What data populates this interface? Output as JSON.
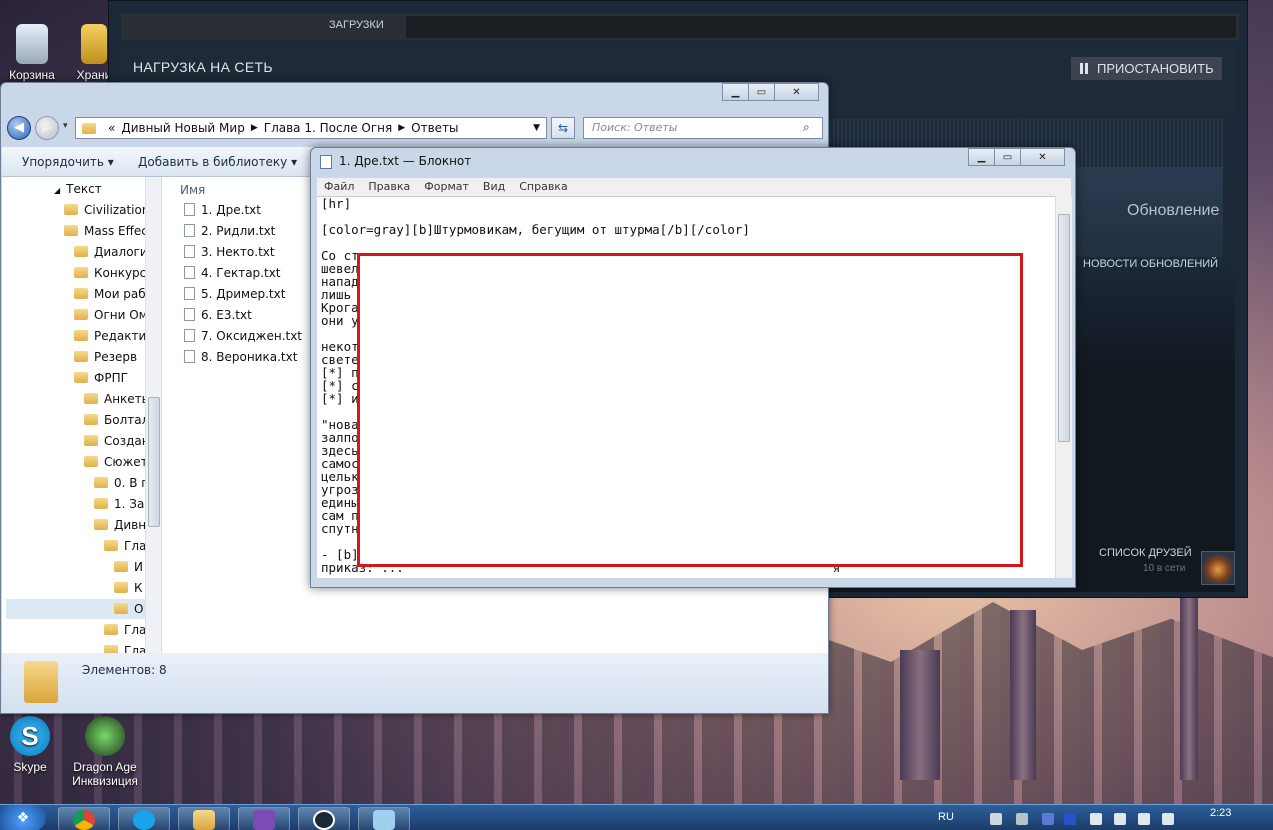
{
  "desktop": {
    "icons_top": [
      {
        "label": "Корзина"
      },
      {
        "label": "Храни"
      }
    ],
    "icons_bottom": [
      {
        "label": "Skype"
      },
      {
        "label": "Dragon Age Инквизиция"
      }
    ]
  },
  "steam": {
    "tab_downloads": "ЗАГРУЗКИ",
    "network_title": "НАГРУЗКА НА СЕТЬ",
    "pause_label": "ПРИОСТАНОВИТЬ",
    "updates_title": "Обновление",
    "update_news": "НОВОСТИ ОБНОВЛЕНИЙ",
    "friends_list": "СПИСОК ДРУЗЕЙ",
    "friends_online": "10 в сети"
  },
  "explorer": {
    "breadcrumbs": [
      "«",
      "Дивный Новый Мир",
      "Глава 1. После Огня",
      "Ответы"
    ],
    "search_placeholder": "Поиск: Ответы",
    "toolbar": {
      "organize": "Упорядочить",
      "add_to_library": "Добавить в библиотеку"
    },
    "tree": [
      {
        "label": "Текст"
      },
      {
        "label": "Civilization"
      },
      {
        "label": "Mass Effect"
      },
      {
        "label": "Диалоги"
      },
      {
        "label": "Конкурсы"
      },
      {
        "label": "Мои раб"
      },
      {
        "label": "Огни Ом"
      },
      {
        "label": "Редактир"
      },
      {
        "label": "Резерв"
      },
      {
        "label": "ФРПГ"
      },
      {
        "label": "Анкеты"
      },
      {
        "label": "Болтал"
      },
      {
        "label": "Создан"
      },
      {
        "label": "Сюжет"
      },
      {
        "label": "0. В п"
      },
      {
        "label": "1. Зав"
      },
      {
        "label": "Дивн"
      },
      {
        "label": "Гла"
      },
      {
        "label": "И"
      },
      {
        "label": "К"
      },
      {
        "label": "О"
      },
      {
        "label": "Гла"
      },
      {
        "label": "Гла"
      }
    ],
    "column_name": "Имя",
    "files": [
      {
        "name": "1. Дре.txt"
      },
      {
        "name": "2. Ридли.txt"
      },
      {
        "name": "3. Некто.txt"
      },
      {
        "name": "4. Гектар.txt"
      },
      {
        "name": "5. Дример.txt"
      },
      {
        "name": "6. Е3.txt"
      },
      {
        "name": "7. Оксиджен.txt"
      },
      {
        "name": "8. Вероника.txt"
      }
    ],
    "status": "Элементов: 8"
  },
  "notepad": {
    "title": "1. Дре.txt — Блокнот",
    "menu": [
      "Файл",
      "Правка",
      "Формат",
      "Вид",
      "Справка"
    ],
    "lines": [
      "[hr]",
      "",
      "[color=gray][b]Штурмовикам, бегущим от штурма[/b][/color]",
      "",
      "Со ст",
      "шевел                                                                бы",
      "напад",
      "лишь",
      "Крога                                                               ем,",
      "они у                                                               ка.",
      "",
      "некот                                                               м",
      "свете",
      "[*] п",
      "[*] с",
      "[*] и",
      "",
      "\"нова",
      "залпо                                                               и",
      "здесь",
      "самос",
      "цельк                                                               ой",
      "угроз                                                               ать",
      "едины",
      "сам п",
      "спутн",
      "",
      "- [b]                                                               й",
      "приказ: ...                                                         я"
    ]
  },
  "taskbar": {
    "language": "RU",
    "time": "2:23"
  }
}
